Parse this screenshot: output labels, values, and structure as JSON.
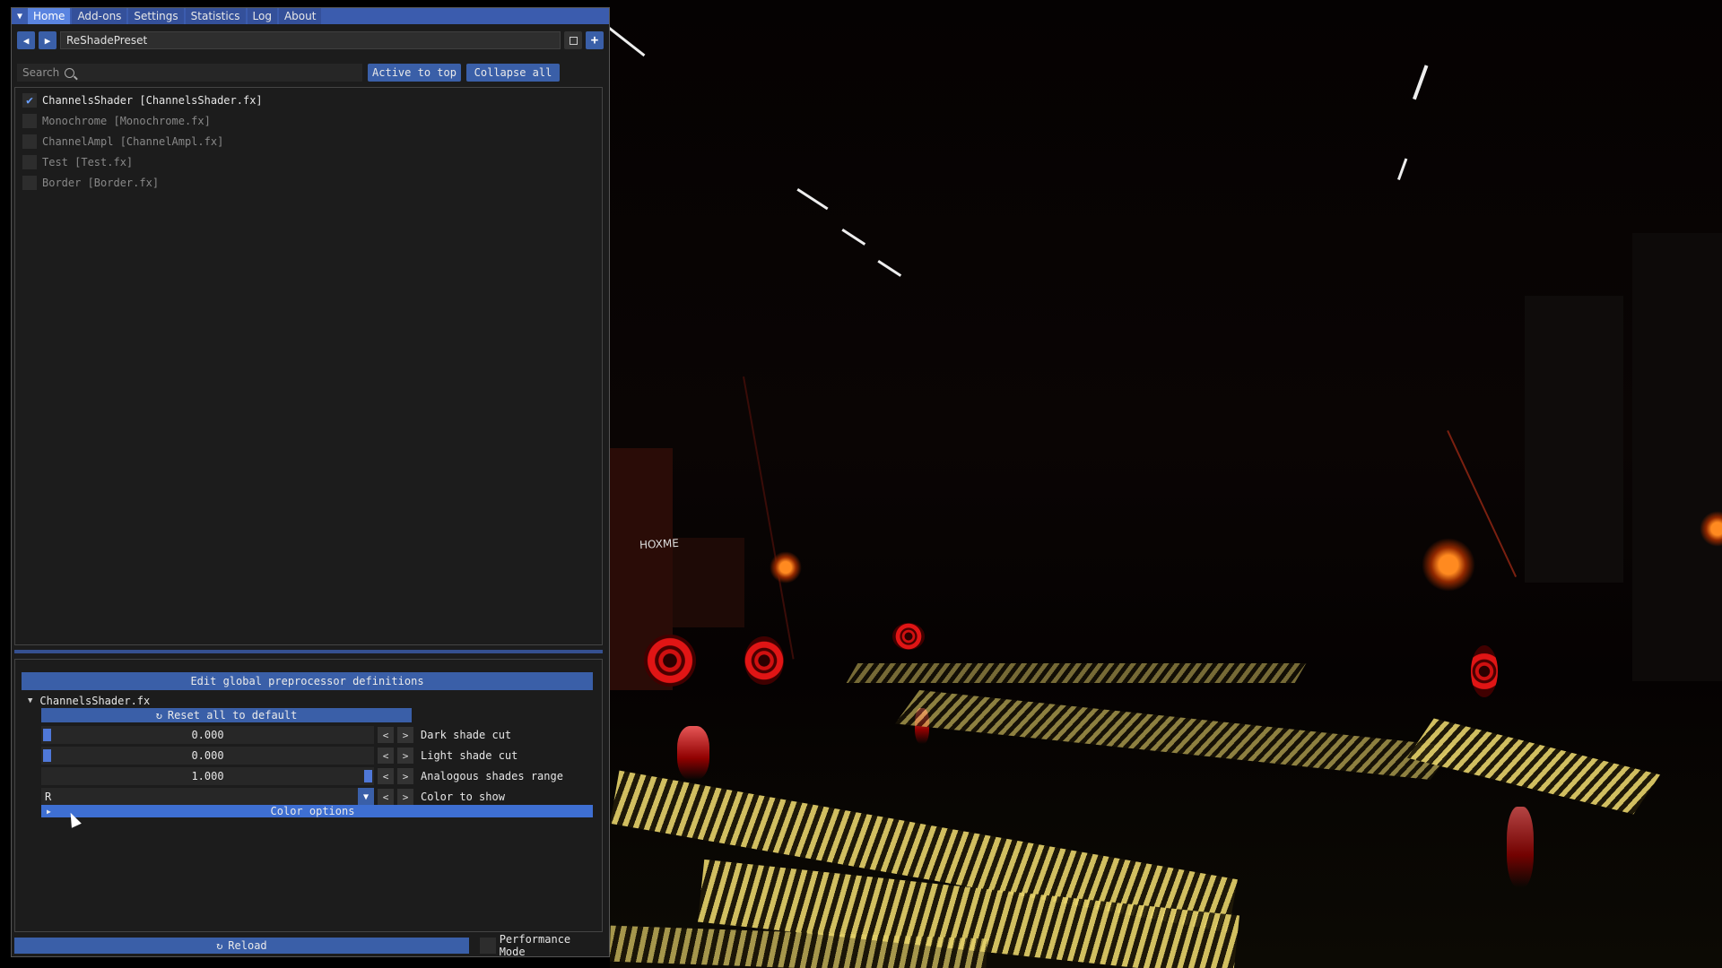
{
  "menu": {
    "tabs": [
      "Home",
      "Add-ons",
      "Settings",
      "Statistics",
      "Log",
      "About"
    ],
    "active": "Home"
  },
  "preset": {
    "back_icon": "arrow-left-icon",
    "forward_icon": "arrow-right-icon",
    "name": "ReShadePreset",
    "save_icon": "save-icon",
    "add_icon": "plus-icon"
  },
  "search": {
    "placeholder": "Search",
    "active_to_top": "Active to top",
    "collapse_all": "Collapse all"
  },
  "effects": [
    {
      "label": "ChannelsShader [ChannelsShader.fx]",
      "enabled": true
    },
    {
      "label": "Monochrome [Monochrome.fx]",
      "enabled": false
    },
    {
      "label": "ChannelAmpl [ChannelAmpl.fx]",
      "enabled": false
    },
    {
      "label": "Test [Test.fx]",
      "enabled": false
    },
    {
      "label": "Border [Border.fx]",
      "enabled": false
    }
  ],
  "params": {
    "global_defs_button": "Edit global preprocessor definitions",
    "section_title": "ChannelsShader.fx",
    "reset_button": "Reset all to default",
    "rows": [
      {
        "value": "0.000",
        "label": "Dark shade cut",
        "level": 0.0
      },
      {
        "value": "0.000",
        "label": "Light shade cut",
        "level": 0.0
      },
      {
        "value": "1.000",
        "label": "Analogous shades range",
        "level": 1.0
      }
    ],
    "combo": {
      "value": "R",
      "label": "Color to show"
    },
    "color_options": "Color options",
    "dec": "<",
    "inc": ">"
  },
  "footer": {
    "reload": "Reload",
    "performance_mode": "Performance Mode"
  },
  "scene": {
    "sign_text": "HOXME"
  }
}
